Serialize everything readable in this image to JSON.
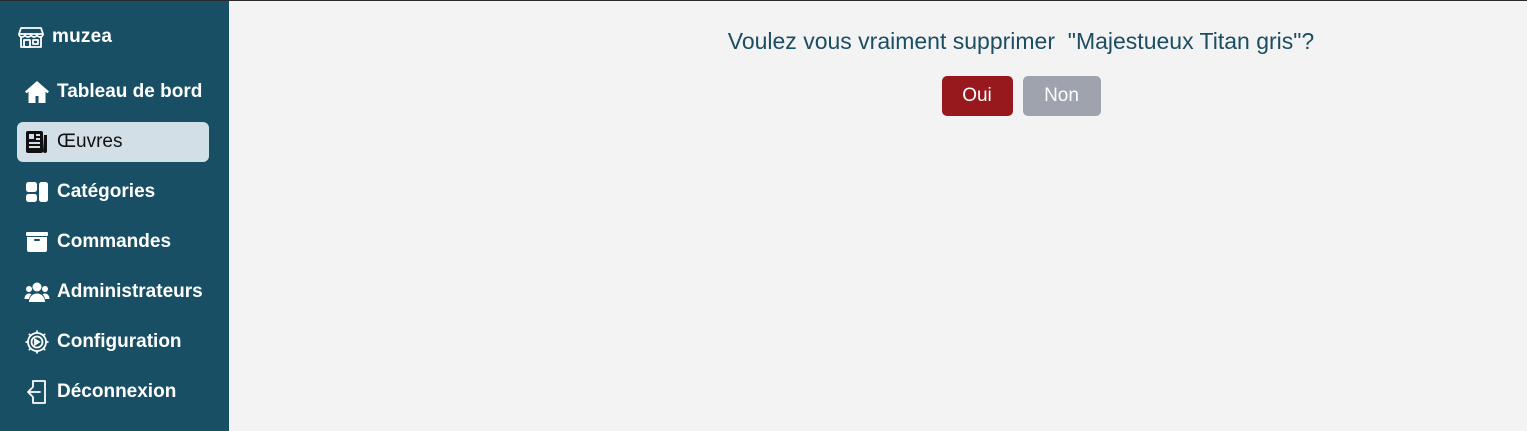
{
  "app": {
    "brand_name": "muzea",
    "brand_icon": "store-icon"
  },
  "sidebar": {
    "items": [
      {
        "label": "Tableau de bord",
        "icon": "home-icon",
        "active": false
      },
      {
        "label": "Œuvres",
        "icon": "newspaper-icon",
        "active": true
      },
      {
        "label": "Catégories",
        "icon": "categories-icon",
        "active": false
      },
      {
        "label": "Commandes",
        "icon": "box-icon",
        "active": false
      },
      {
        "label": "Administrateurs",
        "icon": "users-icon",
        "active": false
      },
      {
        "label": "Configuration",
        "icon": "gear-icon",
        "active": false
      },
      {
        "label": "Déconnexion",
        "icon": "logout-icon",
        "active": false
      }
    ]
  },
  "dialog": {
    "question": "Voulez vous vraiment supprimer  \"Majestueux Titan gris\"?",
    "yes_label": "Oui",
    "no_label": "Non"
  },
  "colors": {
    "sidebar_bg": "#184f64",
    "active_item_bg": "#d3dfe6",
    "question_text": "#1b4d63",
    "yes_button": "#97191d",
    "no_button": "#9ea3ae",
    "main_bg": "#f3f3f3"
  }
}
